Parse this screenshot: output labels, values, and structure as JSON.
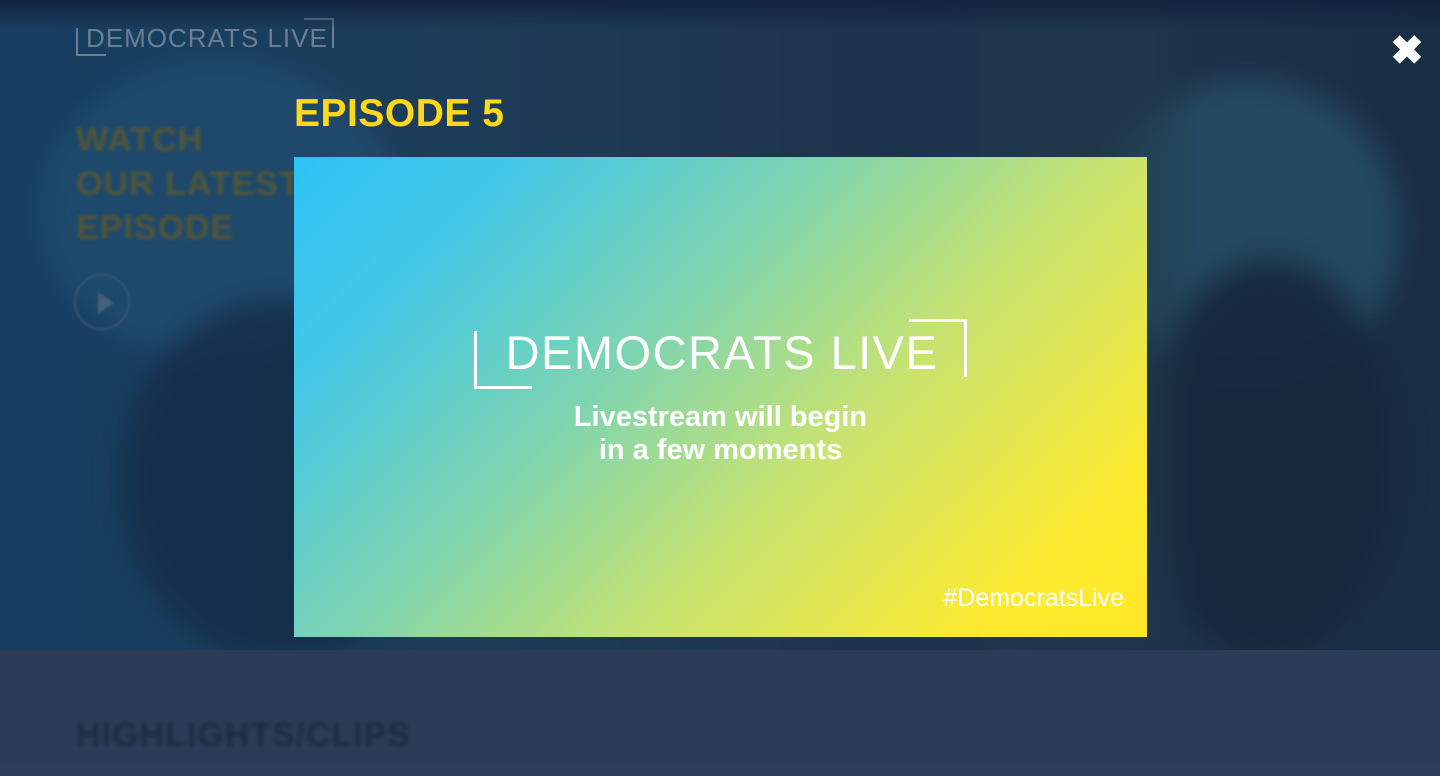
{
  "background": {
    "logo": "DEMOCRATS LIVE",
    "hero_lines": [
      "WATCH",
      "OUR LATEST",
      "EPISODE"
    ],
    "section_heading": "HIGHLIGHTS/CLIPS"
  },
  "modal": {
    "title": "EPISODE 5",
    "close_label": "✖",
    "video": {
      "logo": "DEMOCRATS LIVE",
      "status_line1": "Livestream will begin",
      "status_line2": "in a few moments",
      "hashtag": "#DemocratsLive"
    }
  },
  "colors": {
    "accent_yellow": "#ffd81a",
    "gradient_start": "#2cc2f5",
    "gradient_end": "#ffea2e"
  }
}
